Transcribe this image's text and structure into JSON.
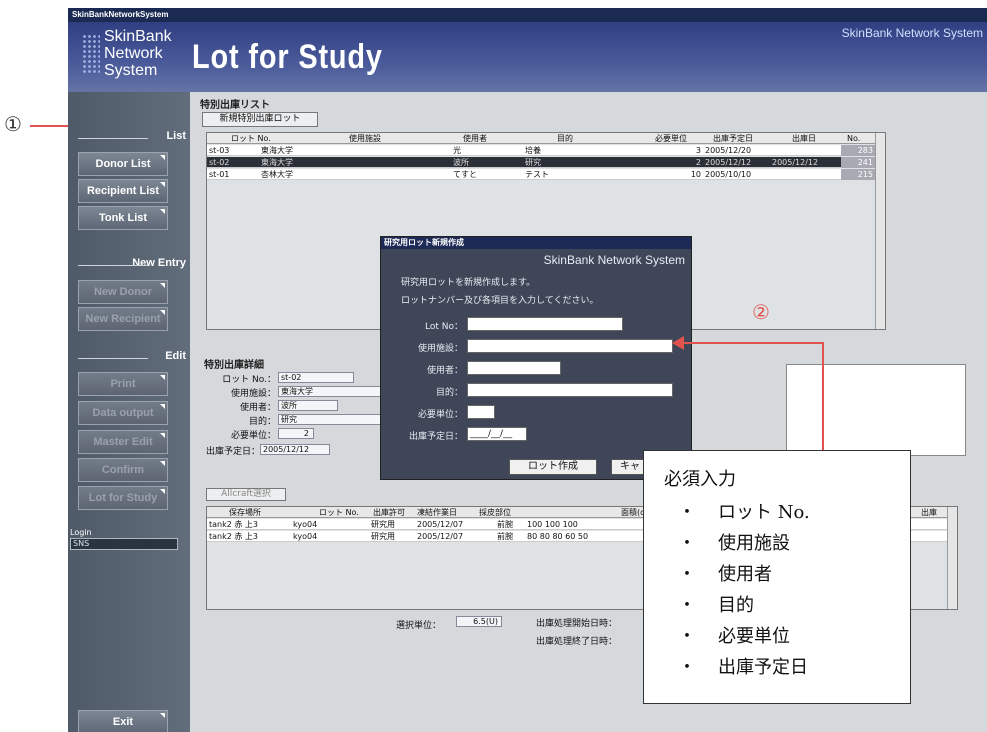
{
  "annotations": {
    "marker1": "①",
    "marker2": "②",
    "required_box": {
      "title": "必須入力",
      "items": [
        "ロット No.",
        "使用施設",
        "使用者",
        "目的",
        "必要単位",
        "出庫予定日"
      ]
    }
  },
  "app": {
    "window_title": "SkinBankNetworkSystem",
    "logo_lines": [
      "SkinBank",
      "Network",
      "System"
    ],
    "page_title": "Lot for Study",
    "brand": "SkinBank Network System"
  },
  "sidebar": {
    "section_list": "List",
    "list_buttons": [
      "Donor List",
      "Recipient List",
      "Tonk List"
    ],
    "section_new": "New Entry",
    "new_buttons": [
      "New Donor",
      "New Recipient"
    ],
    "section_edit": "Edit",
    "edit_buttons": [
      "Print",
      "Data output",
      "Master Edit",
      "Confirm",
      "Lot for Study"
    ],
    "login_label": "Login",
    "login_value": "SNS",
    "exit_label": "Exit"
  },
  "list_panel": {
    "title": "特別出庫リスト",
    "new_lot_button": "新規特別出庫ロット",
    "columns": [
      "ロット No.",
      "使用施設",
      "使用者",
      "目的",
      "必要単位",
      "出庫予定日",
      "出庫日",
      "No."
    ],
    "rows": [
      [
        "st-03",
        "東海大学",
        "光",
        "培養",
        "3",
        "2005/12/20",
        "",
        "283"
      ],
      [
        "st-02",
        "東海大学",
        "波所",
        "研究",
        "2",
        "2005/12/12",
        "2005/12/12",
        "241"
      ],
      [
        "st-01",
        "杏林大学",
        "てすと",
        "テスト",
        "10",
        "2005/10/10",
        "",
        "215"
      ]
    ]
  },
  "detail_panel": {
    "title": "特別出庫詳細",
    "labels": [
      "ロット No.：",
      "使用施設：",
      "使用者：",
      "目的：",
      "必要単位：",
      "出庫予定日："
    ],
    "values": [
      "st-02",
      "東海大学",
      "波所",
      "研究",
      "2",
      "2005/12/12"
    ],
    "allcraft_button": "Allcraft選択",
    "columns": [
      "保存場所",
      "ロット No.",
      "出庫許可",
      "凍結作業日",
      "採皮部位",
      "面積(c",
      "出庫"
    ],
    "rows": [
      [
        "tank2 赤 上3",
        "kyo04",
        "研究用",
        "2005/12/07",
        "前腕",
        "100 100 100"
      ],
      [
        "tank2 赤 上3",
        "kyo04",
        "研究用",
        "2005/12/07",
        "前腕",
        "80 80 80 60 50"
      ]
    ],
    "unit_label": "選択単位：",
    "unit_value": "6.5(U)",
    "start_label": "出庫処理開始日時：",
    "end_label": "出庫処理終了日時："
  },
  "dialog": {
    "title": "研究用ロット新規作成",
    "brand": "SkinBank Network System",
    "message1": "研究用ロットを新規作成します。",
    "message2": "ロットナンバー及び各項目を入力してください。",
    "fields": [
      "Lot No：",
      "使用施設：",
      "使用者：",
      "目的：",
      "必要単位：",
      "出庫予定日："
    ],
    "date_placeholder": "____/__/__",
    "create_button": "ロット作成",
    "cancel_button": "キャ"
  },
  "colors": {
    "header_blue": "#2f3f82",
    "sidebar_gray": "#5a6673",
    "annotation_red": "#e0534e",
    "dialog_bg": "#3e4658"
  }
}
